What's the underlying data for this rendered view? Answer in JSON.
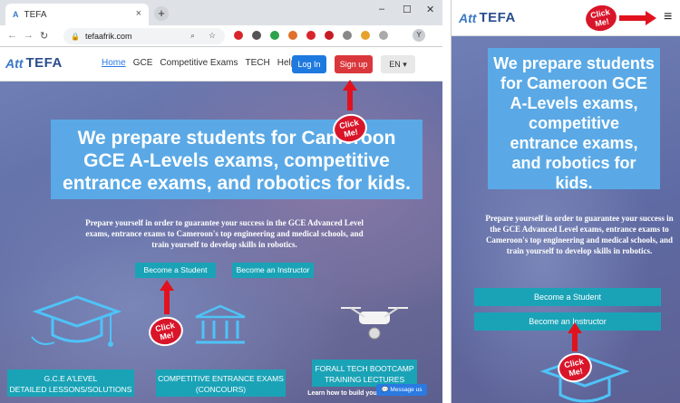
{
  "browser": {
    "tab_title": "TEFA",
    "tab_close": "×",
    "new_tab": "+",
    "url": "tefaafrik.com",
    "window_controls": [
      "–",
      "☐",
      "✕"
    ],
    "profile_initial": "Y"
  },
  "site": {
    "logo_mark": "Att",
    "logo_text": "TEFA",
    "menu": [
      "Home",
      "GCE",
      "Competitive Exams",
      "TECH",
      "Help"
    ],
    "help_suffix": "?",
    "login_label": "Log In",
    "signup_label": "Sign up",
    "lang_label": "EN ▾",
    "hero_title": "We prepare students for Cameroon GCE A-Levels exams, competitive entrance exams, and robotics for kids.",
    "hero_subtitle": "Prepare yourself in order to guarantee your success in the GCE Advanced Level exams, entrance exams to Cameroon's top engineering and medical schools, and train yourself to develop skills in robotics.",
    "cta_student": "Become a Student",
    "cta_instructor": "Become an Instructor",
    "cards": [
      {
        "line1": "G.C.E A'LEVEL",
        "line2": "DETAILED LESSONS/SOLUTIONS"
      },
      {
        "line1": "COMPETITIVE ENTRANCE EXAMS",
        "line2": "(CONCOURS)"
      },
      {
        "line1": "FORALL TECH BOOTCAMP",
        "line2": "TRAINING LECTURES"
      }
    ],
    "card3_sub": "Learn how to build your robots, online",
    "message_button": "💬 Message us"
  },
  "annotations": {
    "click_me_line1": "Click",
    "click_me_line2": "Me!"
  },
  "mobile": {
    "logo_mark": "Att",
    "logo_text": "TEFA",
    "menu_icon": "≡",
    "hero_title": "We prepare students for Cameroon GCE A-Levels exams, competitive entrance exams, and robotics for kids.",
    "hero_subtitle": "Prepare yourself in order to guarantee your success in the GCE Advanced Level exams, entrance exams to Cameroon's top engineering and medical schools, and train yourself to develop skills in robotics.",
    "cta_student": "Become a Student",
    "cta_instructor": "Become an Instructor"
  },
  "colors": {
    "primary_blue": "#1f7ae0",
    "signup_red": "#d9373c",
    "title_box": "#5aa9e6",
    "teal_button": "#1aa3b7",
    "annotation_red": "#e1121e"
  }
}
